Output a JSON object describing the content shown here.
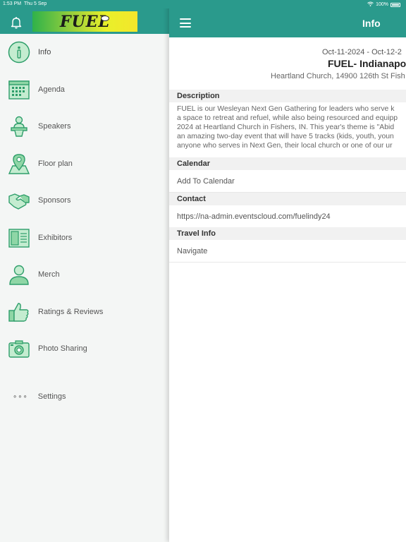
{
  "status_bar": {
    "time": "1:53 PM",
    "date": "Thu 5 Sep",
    "battery": "100%"
  },
  "sidebar": {
    "logo_text": "FUEL",
    "items": [
      {
        "label": "Info",
        "icon": "info-icon"
      },
      {
        "label": "Agenda",
        "icon": "calendar-icon"
      },
      {
        "label": "Speakers",
        "icon": "speaker-icon"
      },
      {
        "label": "Floor plan",
        "icon": "map-pin-icon"
      },
      {
        "label": "Sponsors",
        "icon": "handshake-icon"
      },
      {
        "label": "Exhibitors",
        "icon": "book-icon"
      },
      {
        "label": "Merch",
        "icon": "person-icon"
      },
      {
        "label": "Ratings & Reviews",
        "icon": "thumbs-up-icon"
      },
      {
        "label": "Photo Sharing",
        "icon": "camera-icon"
      }
    ],
    "settings": {
      "dots": "∘∘∘",
      "label": "Settings"
    }
  },
  "main": {
    "title": "Info",
    "event": {
      "date": "Oct-11-2024 - Oct-12-2",
      "name": "FUEL- Indianapo",
      "address": "Heartland Church, 14900 126th St  Fish"
    },
    "sections": {
      "description_header": "Description",
      "description_lines": [
        "FUEL is our Wesleyan Next Gen Gathering for leaders who serve k",
        "a space to retreat and refuel, while also being resourced and equipp",
        "2024 at Heartland Church in Fishers, IN. This year's theme is \"Abid",
        "an amazing two-day event that will have 5 tracks (kids, youth, youn",
        "anyone who serves in Next Gen, their local church or one of our ur"
      ],
      "calendar_header": "Calendar",
      "calendar_action": "Add To Calendar",
      "contact_header": "Contact",
      "contact_link": "https://na-admin.eventscloud.com/fuelindy24",
      "travel_header": "Travel Info",
      "travel_action": "Navigate"
    }
  },
  "colors": {
    "header": "#2a9a8c",
    "icon_fill": "#9fe0b0",
    "icon_stroke": "#2e9e6a"
  }
}
